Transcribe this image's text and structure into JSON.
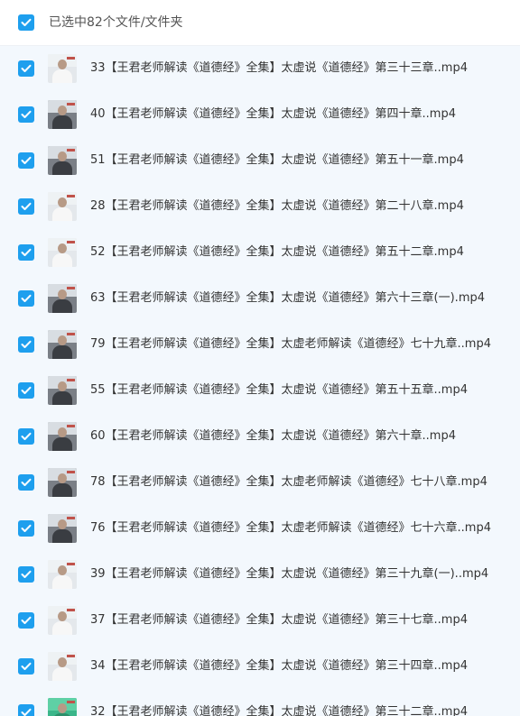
{
  "header": {
    "selection_text": "已选中82个文件/文件夹",
    "select_all_checked": true
  },
  "colors": {
    "checkbox_blue": "#1e9fee",
    "list_background": "#f3f8fd"
  },
  "files": [
    {
      "name": "33【王君老师解读《道德经》全集】太虚说《道德经》第三十三章..mp4",
      "checked": true,
      "thumb": "light"
    },
    {
      "name": "40【王君老师解读《道德经》全集】太虚说《道德经》第四十章..mp4",
      "checked": true,
      "thumb": "dark"
    },
    {
      "name": "51【王君老师解读《道德经》全集】太虚说《道德经》第五十一章.mp4",
      "checked": true,
      "thumb": "dark"
    },
    {
      "name": "28【王君老师解读《道德经》全集】太虚说《道德经》第二十八章.mp4",
      "checked": true,
      "thumb": "light"
    },
    {
      "name": "52【王君老师解读《道德经》全集】太虚说《道德经》第五十二章.mp4",
      "checked": true,
      "thumb": "light"
    },
    {
      "name": "63【王君老师解读《道德经》全集】太虚说《道德经》第六十三章(一).mp4",
      "checked": true,
      "thumb": "dark"
    },
    {
      "name": "79【王君老师解读《道德经》全集】太虚老师解读《道德经》七十九章..mp4",
      "checked": true,
      "thumb": "dark"
    },
    {
      "name": "55【王君老师解读《道德经》全集】太虚说《道德经》第五十五章..mp4",
      "checked": true,
      "thumb": "dark"
    },
    {
      "name": "60【王君老师解读《道德经》全集】太虚说《道德经》第六十章..mp4",
      "checked": true,
      "thumb": "dark"
    },
    {
      "name": "78【王君老师解读《道德经》全集】太虚老师解读《道德经》七十八章.mp4",
      "checked": true,
      "thumb": "dark"
    },
    {
      "name": "76【王君老师解读《道德经》全集】太虚老师解读《道德经》七十六章..mp4",
      "checked": true,
      "thumb": "dark"
    },
    {
      "name": "39【王君老师解读《道德经》全集】太虚说《道德经》第三十九章(一)..mp4",
      "checked": true,
      "thumb": "light"
    },
    {
      "name": "37【王君老师解读《道德经》全集】太虚说《道德经》第三十七章..mp4",
      "checked": true,
      "thumb": "light"
    },
    {
      "name": "34【王君老师解读《道德经》全集】太虚说《道德经》第三十四章..mp4",
      "checked": true,
      "thumb": "light"
    },
    {
      "name": "32【王君老师解读《道德经》全集】太虚说《道德经》第三十二章..mp4",
      "checked": true,
      "thumb": "green"
    }
  ]
}
